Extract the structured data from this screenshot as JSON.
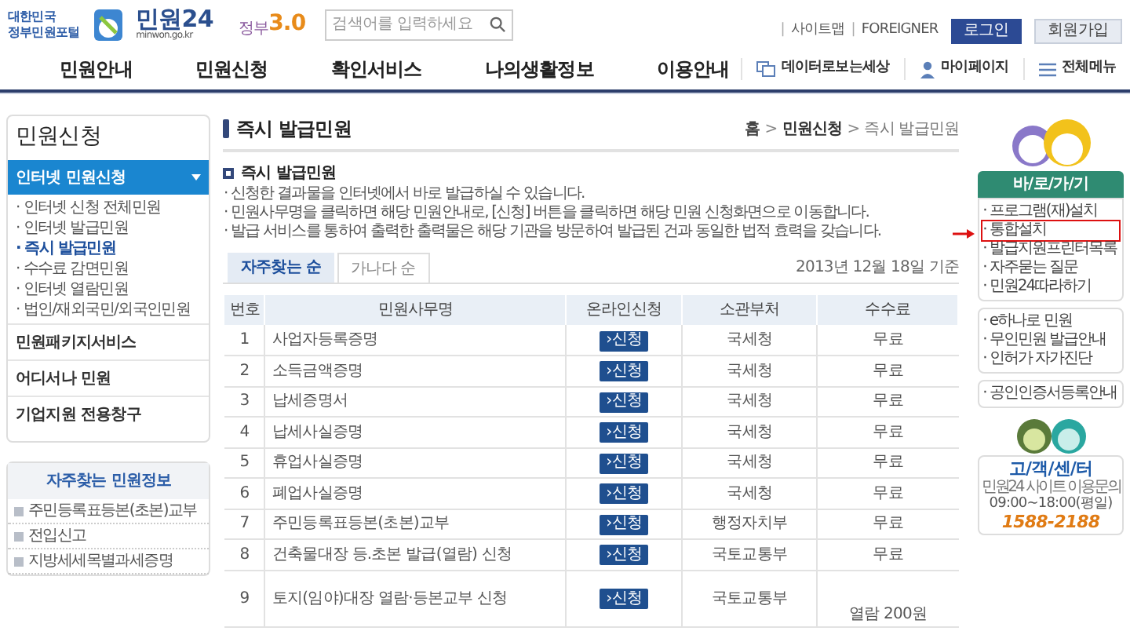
{
  "header": {
    "portal_label": [
      "대한민국",
      "정부민원포털"
    ],
    "logo": {
      "name": "민원24",
      "domain": "minwon.go.kr"
    },
    "gov30": {
      "label": "정부",
      "num": "3.0"
    },
    "search": {
      "placeholder": "검색어를 입력하세요"
    },
    "util_links": [
      "사이트맵",
      "FOREIGNER"
    ],
    "util_separator": "|",
    "buttons": [
      {
        "label": "로그인",
        "kind": "primary"
      },
      {
        "label": "회원가입",
        "kind": "secondary"
      }
    ]
  },
  "nav": {
    "items": [
      "민원안내",
      "민원신청",
      "확인서비스",
      "나의생활정보",
      "이용안내"
    ],
    "extras": [
      {
        "label": "데이터로보는세상",
        "kind": "data"
      },
      {
        "label": "마이페이지",
        "kind": "user"
      },
      {
        "label": "전체메뉴",
        "kind": "menu"
      }
    ]
  },
  "sidebar": {
    "title": "민원신청",
    "sections": [
      {
        "label": "인터넷 민원신청",
        "selected": true,
        "expanded": true,
        "children": [
          {
            "label": "· 인터넷 신청 전체민원",
            "selected": false
          },
          {
            "label": "· 인터넷 발급민원",
            "selected": false
          },
          {
            "label": "· 즉시 발급민원",
            "selected": true
          },
          {
            "label": "· 수수료 감면민원",
            "selected": false
          },
          {
            "label": "· 인터넷 열람민원",
            "selected": false
          },
          {
            "label": "· 법인/재외국민/외국인민원",
            "selected": false
          }
        ]
      },
      {
        "label": "민원패키지서비스",
        "selected": false,
        "expanded": false
      },
      {
        "label": "어디서나 민원",
        "selected": false,
        "expanded": false
      },
      {
        "label": "기업지원 전용창구",
        "selected": false,
        "expanded": false
      }
    ]
  },
  "faq_box": {
    "title": "자주찾는 민원정보",
    "items": [
      "주민등록표등본(초본)교부",
      "전입신고",
      "지방세세목별과세증명"
    ]
  },
  "page": {
    "title": "즉시 발급민원",
    "breadcrumb": [
      "홈",
      "민원신청",
      "즉시 발급민원"
    ],
    "separator": ">"
  },
  "notice": {
    "title": "즉시 발급민원",
    "lines": [
      "· 신청한 결과물을 인터넷에서 바로 발급하실 수 있습니다.",
      "· 민원사무명을 클릭하면 해당 민원안내로, [신청] 버튼을 클릭하면 해당 민원 신청화면으로 이동합니다.",
      "· 발급 서비스를 통하여 출력한 출력물은 해당 기관을 방문하여 발급된 건과 동일한 법적 효력을 갖습니다."
    ]
  },
  "tabs": [
    {
      "label": "자주찾는 순",
      "selected": true
    },
    {
      "label": "가나다 순",
      "selected": false
    }
  ],
  "as_of": "2013년 12월 18일 기준",
  "table": {
    "columns": [
      "번호",
      "민원사무명",
      "온라인신청",
      "소관부처",
      "수수료"
    ],
    "rows": [
      {
        "no": "1",
        "name": "사업자등록증명",
        "action": "›신청",
        "dept": "국세청",
        "fee": "무료"
      },
      {
        "no": "2",
        "name": "소득금액증명",
        "action": "›신청",
        "dept": "국세청",
        "fee": "무료"
      },
      {
        "no": "3",
        "name": "납세증명서",
        "action": "›신청",
        "dept": "국세청",
        "fee": "무료"
      },
      {
        "no": "4",
        "name": "납세사실증명",
        "action": "›신청",
        "dept": "국세청",
        "fee": "무료"
      },
      {
        "no": "5",
        "name": "휴업사실증명",
        "action": "›신청",
        "dept": "국세청",
        "fee": "무료"
      },
      {
        "no": "6",
        "name": "폐업사실증명",
        "action": "›신청",
        "dept": "국세청",
        "fee": "무료"
      },
      {
        "no": "7",
        "name": "주민등록표등본(초본)교부",
        "action": "›신청",
        "dept": "행정자치부",
        "fee": "무료"
      },
      {
        "no": "8",
        "name": "건축물대장 등.초본 발급(열람) 신청",
        "action": "›신청",
        "dept": "국토교통부",
        "fee": "무료"
      },
      {
        "no": "9",
        "name": "토지(임야)대장 열람·등본교부 신청",
        "action": "›신청",
        "dept": "국토교통부",
        "fee": "열람 200원"
      }
    ]
  },
  "quick": {
    "title": "바/로/가/기",
    "groups": [
      [
        {
          "label": "· 프로그램(재)설치",
          "marked": false
        },
        {
          "label": "· 통합설치",
          "marked": true
        },
        {
          "label": "· 발급지원프린터목록",
          "marked": false
        },
        {
          "label": "· 자주묻는 질문",
          "marked": false
        },
        {
          "label": "· 민원24따라하기",
          "marked": false
        }
      ],
      [
        {
          "label": "· e하나로 민원",
          "marked": false
        },
        {
          "label": "· 무인민원 발급안내",
          "marked": false
        },
        {
          "label": "· 인허가 자가진단",
          "marked": false
        }
      ],
      [
        {
          "label": "· 공인인증서등록안내",
          "marked": false
        }
      ]
    ]
  },
  "customer_center": {
    "title": "고/객/센/터",
    "subtitle": "민원24 사이트 이용문의",
    "hours": "09:00~18:00(평일)",
    "phone": "1588-2188"
  }
}
